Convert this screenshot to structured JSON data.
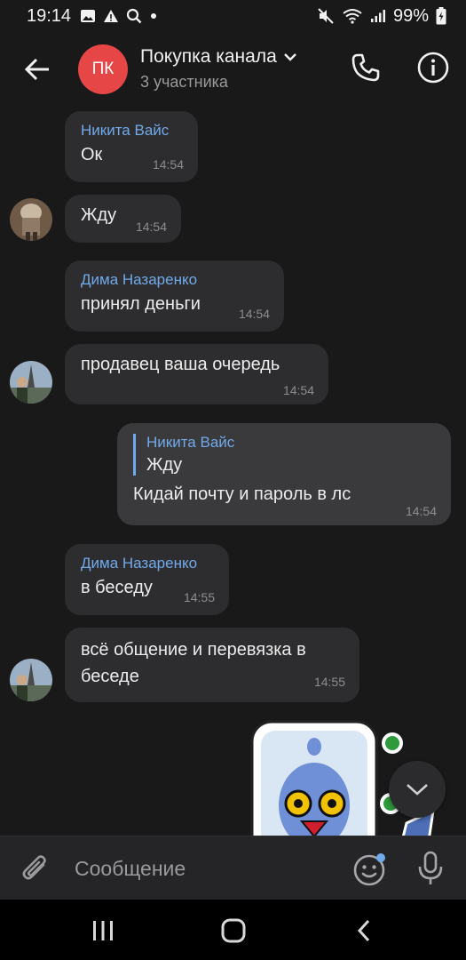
{
  "status_bar": {
    "time": "19:14",
    "battery": "99%",
    "left_icons": [
      "gallery-icon",
      "alert-icon",
      "search-icon",
      "dot-icon"
    ],
    "right_icons": [
      "mute-icon",
      "wifi-icon",
      "signal-icon",
      "battery-icon"
    ]
  },
  "header": {
    "avatar_initials": "ПК",
    "avatar_color": "#e64646",
    "title": "Покупка канала",
    "subtitle": "3 участника"
  },
  "messages": [
    {
      "author": "Никита Вайс",
      "text": "Ок",
      "time": "14:54"
    },
    {
      "text": "Жду",
      "time": "14:54"
    },
    {
      "author": "Дима Назаренко",
      "text": "принял деньги",
      "time": "14:54"
    },
    {
      "text": "продавец ваша очередь",
      "time": "14:54"
    },
    {
      "reply_author": "Никита Вайс",
      "reply_text": "Жду",
      "text": "Кидай почту и пароль в лс",
      "time": "14:54"
    },
    {
      "author": "Дима Назаренко",
      "text": "в беседу",
      "time": "14:55"
    },
    {
      "text_line1": "всё общение и перевязка в",
      "text_line2": "беседе",
      "time": "14:55"
    }
  ],
  "composer": {
    "placeholder": "Сообщение"
  },
  "colors": {
    "accent": "#71aaeb",
    "background": "#19191a",
    "bubble": "#2d2d2f"
  }
}
